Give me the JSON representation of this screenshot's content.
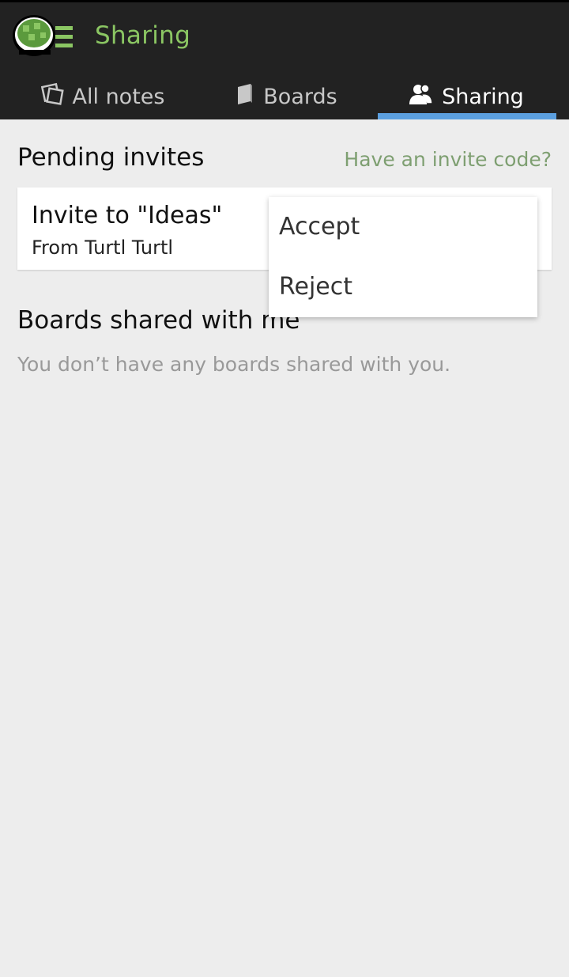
{
  "header": {
    "title": "Sharing",
    "logo_icon": "turtle-logo-icon",
    "accent_color": "#8bc663"
  },
  "tabs": [
    {
      "label": "All notes",
      "icon": "notes-icon"
    },
    {
      "label": "Boards",
      "icon": "board-icon"
    },
    {
      "label": "Sharing",
      "icon": "people-icon",
      "active": true
    }
  ],
  "pending": {
    "title": "Pending invites",
    "invite_code_link": "Have an invite code?",
    "invite": {
      "name": "Invite to \"Ideas\"",
      "from": "From Turtl Turtl"
    }
  },
  "menu": {
    "accept": "Accept",
    "reject": "Reject"
  },
  "shared": {
    "title": "Boards shared with me",
    "empty": "You don’t have any boards shared with you."
  }
}
